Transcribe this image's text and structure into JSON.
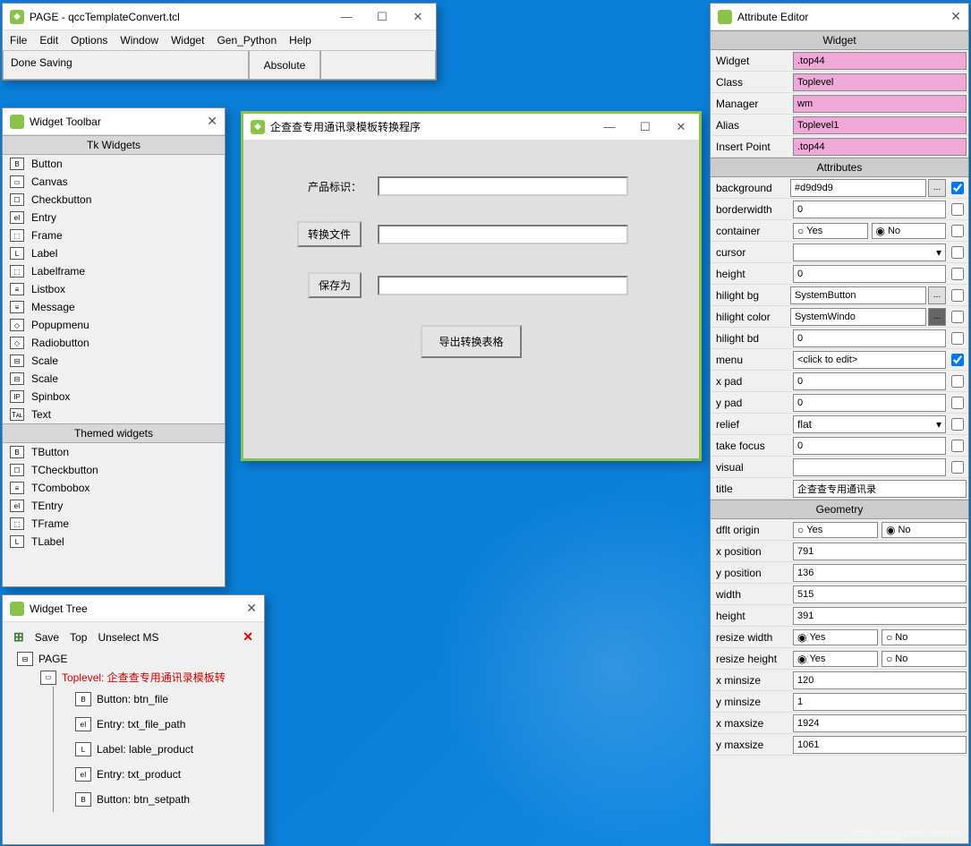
{
  "page_window": {
    "title": "PAGE - qccTemplateConvert.tcl",
    "menu": [
      "File",
      "Edit",
      "Options",
      "Window",
      "Widget",
      "Gen_Python",
      "Help"
    ],
    "status_left": "Done Saving",
    "status_mid": "Absolute"
  },
  "toolbar": {
    "title": "Widget Toolbar",
    "section1": "Tk Widgets",
    "section2": "Themed widgets",
    "tk_items": [
      "Button",
      "Canvas",
      "Checkbutton",
      "Entry",
      "Frame",
      "Label",
      "Labelframe",
      "Listbox",
      "Message",
      "Popupmenu",
      "Radiobutton",
      "Scale",
      "Scale",
      "Spinbox",
      "Text"
    ],
    "tk_icons": [
      "B",
      "▭",
      "☐",
      "eI",
      "⬚",
      "L",
      "⬚",
      "≡",
      "≡",
      "◇",
      "◇",
      "⊟",
      "⊟",
      "IP",
      "Tᴀʟ"
    ],
    "themed_items": [
      "TButton",
      "TCheckbutton",
      "TCombobox",
      "TEntry",
      "TFrame",
      "TLabel"
    ],
    "themed_icons": [
      "B",
      "☐",
      "≡",
      "eI",
      "⬚",
      "L"
    ]
  },
  "design": {
    "title": "企查查专用通讯录模板转换程序",
    "label_product": "产品标识：",
    "btn_file": "转换文件",
    "btn_setpath": "保存为",
    "btn_export": "导出转换表格"
  },
  "tree": {
    "title": "Widget Tree",
    "btn_save": "Save",
    "btn_top": "Top",
    "btn_unselect": "Unselect MS",
    "root": "PAGE",
    "toplevel": "Toplevel: 企查查专用通讯录模板转",
    "children": [
      {
        "icon": "B",
        "label": "Button: btn_file"
      },
      {
        "icon": "eI",
        "label": "Entry: txt_file_path"
      },
      {
        "icon": "L",
        "label": "Label: lable_product"
      },
      {
        "icon": "eI",
        "label": "Entry: txt_product"
      },
      {
        "icon": "B",
        "label": "Button: btn_setpath"
      }
    ]
  },
  "attr": {
    "title": "Attribute Editor",
    "sec_widget": "Widget",
    "sec_attrs": "Attributes",
    "sec_geom": "Geometry",
    "widget_rows": [
      {
        "k": "Widget",
        "v": ".top44"
      },
      {
        "k": "Class",
        "v": "Toplevel"
      },
      {
        "k": "Manager",
        "v": "wm"
      },
      {
        "k": "Alias",
        "v": "Toplevel1"
      },
      {
        "k": "Insert Point",
        "v": ".top44"
      }
    ],
    "attr_rows": [
      {
        "k": "background",
        "v": "#d9d9d9",
        "dots": true,
        "cb": true,
        "checked": true
      },
      {
        "k": "borderwidth",
        "v": "0",
        "cb": true
      },
      {
        "k": "container",
        "radio": true,
        "opts": [
          "Yes",
          "No"
        ],
        "sel": "No",
        "cb": true
      },
      {
        "k": "cursor",
        "select": true,
        "v": "",
        "cb": true
      },
      {
        "k": "height",
        "v": "0",
        "cb": true
      },
      {
        "k": "hilight bg",
        "v": "SystemButton",
        "dots": true,
        "cb": true
      },
      {
        "k": "hilight color",
        "v": "SystemWindo",
        "dots": true,
        "dark": true,
        "cb": true
      },
      {
        "k": "hilight bd",
        "v": "0",
        "cb": true
      },
      {
        "k": "menu",
        "v": "<click to edit>",
        "cb": true,
        "checked": true
      },
      {
        "k": "x pad",
        "v": "0",
        "cb": true
      },
      {
        "k": "y pad",
        "v": "0",
        "cb": true
      },
      {
        "k": "relief",
        "select": true,
        "v": "flat",
        "cb": true
      },
      {
        "k": "take focus",
        "v": "0",
        "cb": true
      },
      {
        "k": "visual",
        "v": "",
        "cb": true
      },
      {
        "k": "title",
        "v": "企查查专用通讯录"
      }
    ],
    "geom_rows": [
      {
        "k": "dflt origin",
        "radio": true,
        "opts": [
          "Yes",
          "No"
        ],
        "sel": "No"
      },
      {
        "k": "x position",
        "v": "791"
      },
      {
        "k": "y position",
        "v": "136"
      },
      {
        "k": "width",
        "v": "515"
      },
      {
        "k": "height",
        "v": "391"
      },
      {
        "k": "resize width",
        "radio": true,
        "opts": [
          "Yes",
          "No"
        ],
        "sel": "Yes"
      },
      {
        "k": "resize height",
        "radio": true,
        "opts": [
          "Yes",
          "No"
        ],
        "sel": "Yes"
      },
      {
        "k": "x minsize",
        "v": "120"
      },
      {
        "k": "y minsize",
        "v": "1"
      },
      {
        "k": "x maxsize",
        "v": "1924"
      },
      {
        "k": "y maxsize",
        "v": "1061"
      }
    ]
  },
  "watermark": "https://blog.csdn.net/lxbin"
}
